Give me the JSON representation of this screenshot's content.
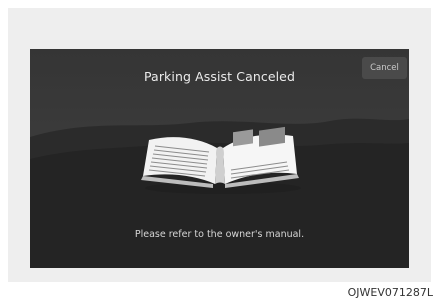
{
  "screen": {
    "title": "Parking Assist Canceled",
    "cancel_label": "Cancel",
    "message": "Please refer to the owner's manual."
  },
  "figure_code": "OJWEV071287L",
  "icons": {
    "manual": "open-book-icon"
  }
}
